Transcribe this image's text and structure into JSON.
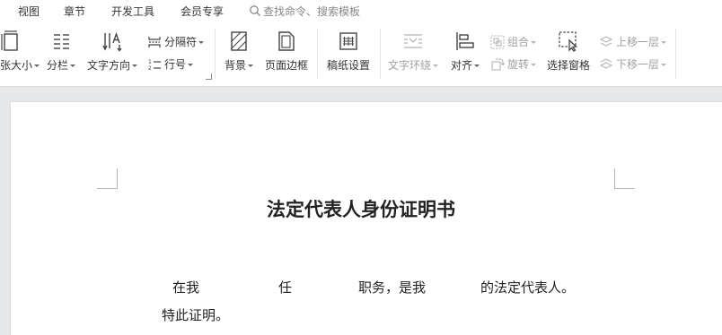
{
  "menubar": {
    "items": [
      "视图",
      "章节",
      "开发工具",
      "会员专享"
    ],
    "search_placeholder": "查找命令、搜索模板"
  },
  "ribbon": {
    "paper_size": "纸张大小",
    "columns": "分栏",
    "text_direction": "文字方向",
    "separator": "分隔符",
    "line_number": "行号",
    "background": "背景",
    "page_border": "页面边框",
    "manuscript": "稿纸设置",
    "text_wrap": "文字环绕",
    "align": "对齐",
    "group": "组合",
    "rotate": "旋转",
    "selection_pane": "选择窗格",
    "bring_forward": "上移一层",
    "send_backward": "下移一层"
  },
  "document": {
    "title": "法定代表人身份证明书",
    "line1": {
      "part_a": "在我",
      "part_b": "任",
      "part_c": "职务，是我",
      "part_d": "的法定代表人。"
    },
    "line2": "特此证明。"
  }
}
